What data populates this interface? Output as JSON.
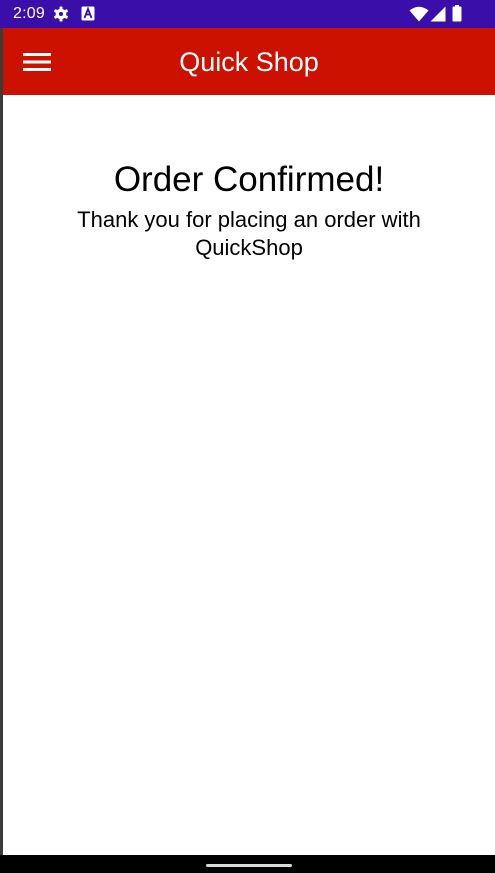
{
  "status_bar": {
    "time": "2:09",
    "icons": [
      "settings-gear-icon",
      "a-badge-icon",
      "wifi-icon",
      "cellular-signal-icon",
      "battery-icon"
    ]
  },
  "app_bar": {
    "title": "Quick Shop",
    "menu_icon": "hamburger-menu-icon",
    "background": "#CC1100"
  },
  "confirmation": {
    "heading": "Order Confirmed!",
    "message": "Thank you for placing an order with QuickShop"
  },
  "colors": {
    "status_bar": "#3A0EA8",
    "app_bar": "#CC1100",
    "content_background": "#FFFFFF",
    "text": "#000000"
  }
}
